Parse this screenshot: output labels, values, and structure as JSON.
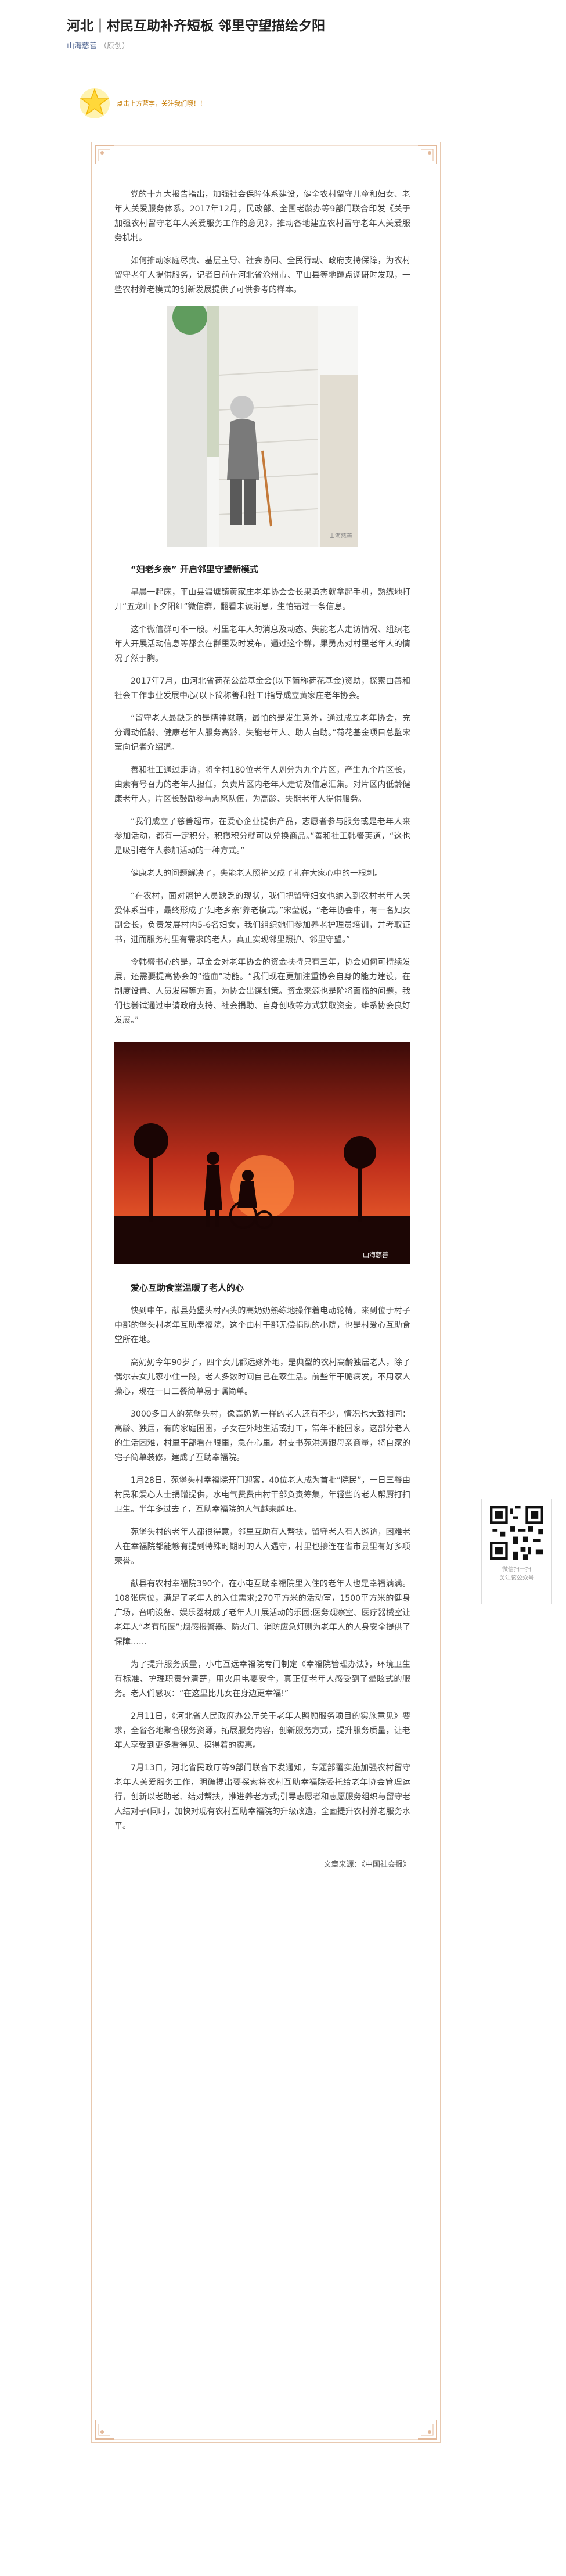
{
  "header": {
    "title": "河北｜村民互助补齐短板 邻里守望描绘夕阳",
    "account": "山海慈善",
    "original_tag": "（原创）"
  },
  "intro_tip": "点击上方蓝字，关注我们哦！！",
  "paragraphs_a": [
    "党的十九大报告指出，加强社会保障体系建设，健全农村留守儿童和妇女、老年人关爱服务体系。2017年12月，民政部、全国老龄办等9部门联合印发《关于加强农村留守老年人关爱服务工作的意见》，推动各地建立农村留守老年人关爱服务机制。",
    "如何推动家庭尽责、基层主导、社会协同、全民行动、政府支持保障，为农村留守老年人提供服务，记者日前在河北省沧州市、平山县等地蹲点调研时发现，一些农村养老模式的创新发展提供了可供参考的样本。"
  ],
  "fig1_credit": "山海慈善",
  "section1_title": "“妇老乡亲” 开启邻里守望新模式",
  "paragraphs_b": [
    "早晨一起床，平山县温塘镇黄家庄老年协会会长果勇杰就拿起手机，熟练地打开“五龙山下夕阳红”微信群，翻看未读消息，生怕错过一条信息。",
    "这个微信群可不一般。村里老年人的消息及动态、失能老人走访情况、组织老年人开展活动信息等都会在群里及时发布，通过这个群，果勇杰对村里老年人的情况了然于胸。",
    "2017年7月，由河北省荷花公益基金会(以下简称荷花基金)资助，探索由善和社会工作事业发展中心(以下简称善和社工)指导成立黄家庄老年协会。",
    "“留守老人最缺乏的是精神慰藉，最怕的是发生意外，通过成立老年协会，充分调动低龄、健康老年人服务高龄、失能老年人、助人自助。”荷花基金项目总监宋莹向记者介绍道。",
    "善和社工通过走访，将全村180位老年人划分为九个片区，产生九个片区长，由素有号召力的老年人担任，负责片区内老年人走访及信息汇集。对片区内低龄健康老年人，片区长鼓励参与志愿队伍，为高龄、失能老年人提供服务。",
    "“我们成立了慈善超市，在爱心企业提供产品，志愿者参与服务或是老年人来参加活动，都有一定积分，积攒积分就可以兑换商品。”善和社工韩盛芙道，“这也是吸引老年人参加活动的一种方式。”",
    "健康老人的问题解决了，失能老人照护又成了扎在大家心中的一根刺。",
    "“在农村，面对照护人员缺乏的现状，我们把留守妇女也纳入到农村老年人关爱体系当中，最终形成了‘妇老乡亲’养老模式。”宋莹说，“老年协会中，有一名妇女副会长，负责发展村内5-6名妇女，我们组织她们参加养老护理员培训，并考取证书，进而服务村里有需求的老人，真正实现邻里照护、邻里守望。”",
    "令韩盛书心的是，基金会对老年协会的资金扶持只有三年，协会如何可持续发展，还需要提高协会的“造血”功能。“我们现在更加注重协会自身的能力建设，在制度设置、人员发展等方面，为协会出谋划策。资金来源也是阶将面临的问题，我们也尝试通过申请政府支持、社会捐助、自身创收等方式获取资金，维系协会良好发展。”"
  ],
  "fig2_credit": "山海慈善",
  "section2_title": "爱心互助食堂温暖了老人的心",
  "paragraphs_c": [
    "快到中午，献县苑堡头村西头的高奶奶熟练地操作着电动轮椅，来到位于村子中部的堡头村老年互助幸福院，这个由村干部无偿捐助的小院，也是村爱心互助食堂所在地。",
    "高奶奶今年90岁了，四个女儿都远嫁外地，是典型的农村高龄独居老人，除了偶尔去女儿家小住一段，老人多数时间自己在家生活。前些年干脆病发，不用家人操心，现在一日三餐简单易于嘱简单。",
    "3000多口人的苑堡头村，像高奶奶一样的老人还有不少，情况也大致相同：高龄、独居，有的家庭困困，子女在外地生活或打工，常年不能回家。这部分老人的生活困难，村里干部看在眼里，急在心里。村支书苑洪涛跟母亲商量，将自家的宅子简单装修，建成了互助幸福院。",
    "1月28日，苑堡头村幸福院开门迎客，40位老人成为首批“院民”，一日三餐由村民和爱心人士捐赠提供，水电气费费由村干部负责筹集，年轻些的老人帮厨打扫卫生。半年多过去了，互助幸福院的人气越来越旺。",
    "苑堡头村的老年人都很得意，邻里互助有人帮扶，留守老人有人巡访，困难老人在幸福院都能够有提到特殊时期时的人人遇守，村里也接连在省市县里有好多项荣誉。",
    "献县有农村幸福院390个，在小屯互助幸福院里入住的老年人也是幸福满满。108张床位，满足了老年人的入住需求;270平方米的活动室，1500平方米的健身广场，音响设备、娱乐器材成了老年人开展活动的乐园;医务观察室、医疗器械室让老年人“老有所医”;烟感报警器、防火门、消防应急灯则为老年人的人身安全提供了保障……",
    "为了提升服务质量，小屯互远幸福院专门制定《幸福院管理办法》，环境卫生有标准、护理职责分清楚，用火用电要安全，真正使老年人感受到了晕眩式的服务。老人们感叹：“在这里比儿女在身边更幸福!”",
    "2月11日，《河北省人民政府办公厅关于老年人照顾服务项目的实施意见》要求，全省各地聚合服务资源，拓展服务内容，创新服务方式，提升服务质量，让老年人享受到更多看得见、摸得着的实惠。",
    "7月13日，河北省民政厅等9部门联合下发通知，专题部署实施加强农村留守老年人关爱服务工作，明确提出要探索将农村互助幸福院委托给老年协会管理运行，创新以老助老、结对帮扶，推进养老方式;引导志愿者和志愿服务组织与留守老人结对子(同时，加快对现有农村互助幸福院的升级改造，全面提升农村养老服务水平。"
  ],
  "source_line": "文章来源：《中国社会报》",
  "qr": {
    "line1": "微信扫一扫",
    "line2": "关注该公众号"
  }
}
